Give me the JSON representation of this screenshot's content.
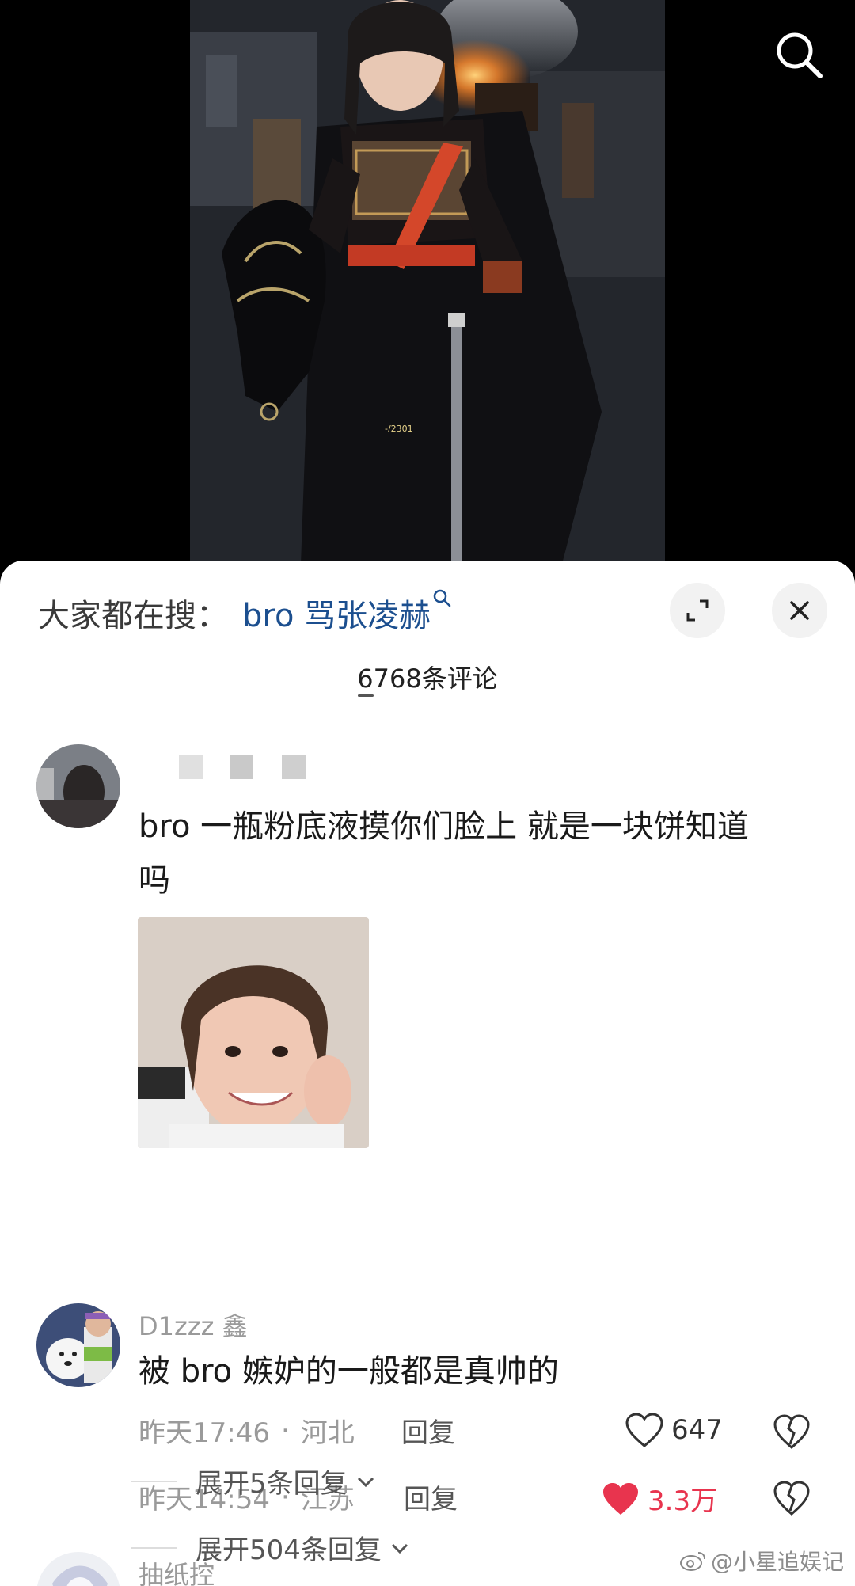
{
  "video": {
    "frame_text": "-/2301",
    "icons": {
      "search": "search-icon"
    }
  },
  "sheet": {
    "hot_search_label": "大家都在搜：",
    "hot_search_keyword": "bro 骂张凌赫",
    "icons": {
      "expand": "expand-icon",
      "close": "close-icon",
      "keyword_search": "search-icon"
    },
    "comment_count": "6768条评论"
  },
  "comments": [
    {
      "username": "",
      "text_line1": "bro 一瓶粉底液摸你们脸上 就是一块饼知道",
      "text_line2": "吗",
      "time": "昨天14:54",
      "location": "江苏",
      "reply_label": "回复",
      "likes": "3.3万",
      "liked": true,
      "expand_replies": "展开504条回复"
    },
    {
      "username": "D1zzz 鑫",
      "text": "被 bro 嫉妒的一般都是真帅的",
      "time": "昨天17:46",
      "location": "河北",
      "reply_label": "回复",
      "likes": "647",
      "liked": false,
      "expand_replies": "展开5条回复"
    },
    {
      "username": "抽纸控"
    }
  ],
  "watermark": "@小星追娱记",
  "colors": {
    "like_active": "#e8344e",
    "keyword": "#1c4f8f",
    "secondary_text": "#9a9a9a"
  }
}
